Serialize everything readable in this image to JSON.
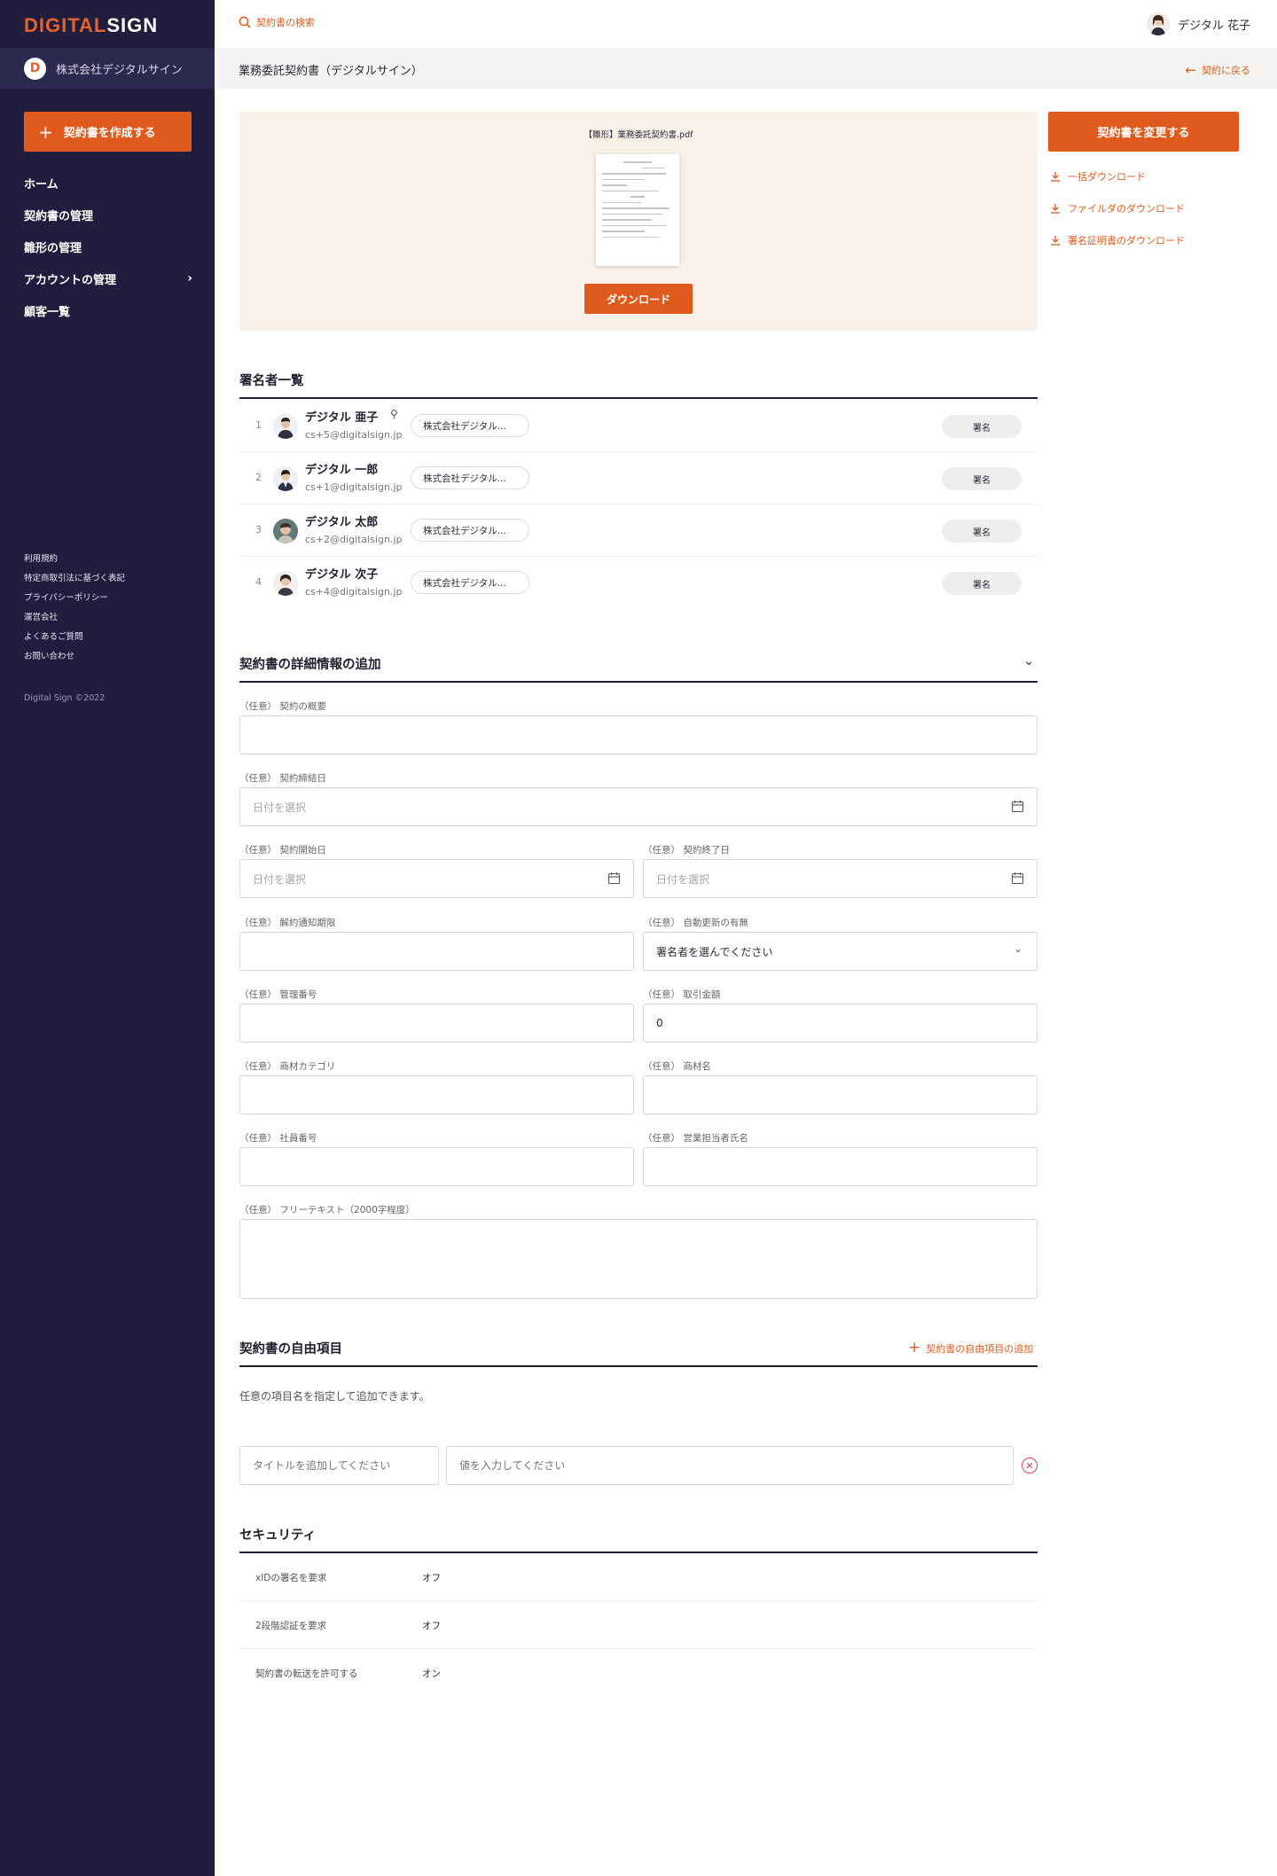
{
  "brand": {
    "logo_a": "DIGITAL",
    "logo_b": "SIGN",
    "accent": "#e05a1e",
    "sidebar_bg": "#211d3f"
  },
  "sidebar": {
    "company_badge": "D",
    "company_name": "株式会社デジタルサイン",
    "create_button": "契約書を作成する",
    "nav": [
      "ホーム",
      "契約書の管理",
      "雛形の管理",
      "アカウントの管理",
      "顧客一覧"
    ],
    "footer_links": [
      "利用規約",
      "特定商取引法に基づく表記",
      "プライバシーポリシー",
      "運営会社",
      "よくあるご質問",
      "お問い合わせ"
    ],
    "copyright": "Digital Sign ©2022"
  },
  "header": {
    "search_label": "契約書の検索",
    "user_name": "デジタル 花子",
    "document_title": "業務委託契約書（デジタルサイン）",
    "back_label": "契約に戻る"
  },
  "preview": {
    "file_name": "【雛形】業務委託契約書.pdf",
    "download_button": "ダウンロード"
  },
  "actions": {
    "change_button": "契約書を変更する",
    "bulk_download": "一括ダウンロード",
    "file_download": "ファイルダのダウンロード",
    "cert_download": "署名証明書のダウンロード"
  },
  "signers": {
    "title": "署名者一覧",
    "list": [
      {
        "no": "1",
        "name": "デジタル 亜子",
        "email": "cs+5@digitalsign.jp",
        "org": "株式会社デジタル...",
        "status": "署名",
        "owner_icon": "key-icon"
      },
      {
        "no": "2",
        "name": "デジタル 一郎",
        "email": "cs+1@digitalsign.jp",
        "org": "株式会社デジタル...",
        "status": "署名"
      },
      {
        "no": "3",
        "name": "デジタル 太郎",
        "email": "cs+2@digitalsign.jp",
        "org": "株式会社デジタル...",
        "status": "署名"
      },
      {
        "no": "4",
        "name": "デジタル 次子",
        "email": "cs+4@digitalsign.jp",
        "org": "株式会社デジタル...",
        "status": "署名"
      }
    ]
  },
  "details": {
    "title": "契約書の詳細情報の追加",
    "summary_label": "（任意） 契約の概要",
    "conclusion_label": "（任意） 契約締結日",
    "conclusion_placeholder": "日付を選択",
    "start_label": "（任意） 契約開始日",
    "start_placeholder": "日付を選択",
    "end_label": "（任意） 契約終了日",
    "end_placeholder": "日付を選択",
    "notice_label": "（任意） 解約通知期限",
    "auto_renew_label": "（任意） 自動更新の有無",
    "auto_renew_value": "署名者を選んでください",
    "mgmt_no_label": "（任意） 管理番号",
    "amount_label": "（任意） 取引金額",
    "amount_value": "0",
    "category_label": "（任意） 商材カテゴリ",
    "product_label": "（任意） 商材名",
    "employee_label": "（任意） 社員番号",
    "sales_label": "（任意） 営業担当者氏名",
    "free_text_label": "（任意） フリーテキスト（2000字程度）"
  },
  "free_items": {
    "title": "契約書の自由項目",
    "add_label": "契約書の自由項目の追加",
    "description": "任意の項目名を指定して追加できます。",
    "title_placeholder": "タイトルを追加してください",
    "value_placeholder": "値を入力してください"
  },
  "security": {
    "title": "セキュリティ",
    "rows": [
      {
        "label": "xIDの署名を要求",
        "value": "オフ"
      },
      {
        "label": "2段階認証を要求",
        "value": "オフ"
      },
      {
        "label": "契約書の転送を許可する",
        "value": "オン"
      }
    ]
  }
}
